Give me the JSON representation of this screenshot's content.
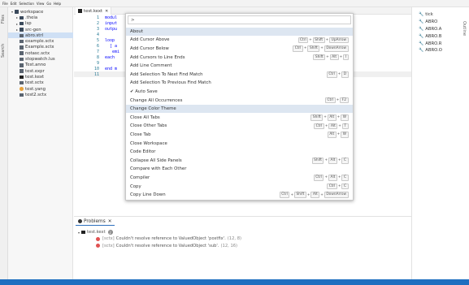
{
  "menubar": [
    "File",
    "Edit",
    "Selection",
    "View",
    "Go",
    "Help"
  ],
  "activity": {
    "files": "Files",
    "search": "Search"
  },
  "explorer": {
    "items": [
      {
        "label": "workspace",
        "type": "folder",
        "twisty": "▾",
        "depth": 0
      },
      {
        "label": ".theia",
        "type": "folder",
        "twisty": "▸",
        "depth": 1
      },
      {
        "label": "lsp",
        "type": "folder",
        "twisty": "▸",
        "depth": 1
      },
      {
        "label": "src-gen",
        "type": "folder",
        "twisty": "▸",
        "depth": 1
      },
      {
        "label": "abro.strl",
        "type": "file",
        "depth": 1,
        "selected": true
      },
      {
        "label": "example.sctx",
        "type": "file",
        "depth": 1
      },
      {
        "label": "Example.sctx",
        "type": "file",
        "depth": 1
      },
      {
        "label": "notasc.sctx",
        "type": "file",
        "depth": 1
      },
      {
        "label": "stopwatch.lus",
        "type": "file",
        "depth": 1
      },
      {
        "label": "Test.anno",
        "type": "file",
        "depth": 1
      },
      {
        "label": "test.expr",
        "type": "file",
        "depth": 1
      },
      {
        "label": "test.kext",
        "type": "kext",
        "depth": 1
      },
      {
        "label": "test.sctx",
        "type": "file",
        "depth": 1
      },
      {
        "label": "test.yang",
        "type": "yang",
        "depth": 1
      },
      {
        "label": "test2.sctx",
        "type": "file",
        "depth": 1
      }
    ]
  },
  "editor": {
    "tab_label": "test.kext",
    "tab_close": "✕",
    "line_numbers": [
      "1",
      "2",
      "3",
      "4",
      "5",
      "6",
      "7",
      "8",
      "9",
      "10",
      "11"
    ],
    "lines": [
      "modul",
      "input",
      "outpu",
      "",
      "loop",
      "  [ a",
      "   emi",
      "each",
      "",
      "end m",
      ""
    ]
  },
  "quickpick": {
    "input_value": ">",
    "items": [
      {
        "label": "About",
        "keys": [],
        "highlight": true
      },
      {
        "label": "Add Cursor Above",
        "keys": [
          "Ctrl",
          "Shift",
          "UpArrow"
        ]
      },
      {
        "label": "Add Cursor Below",
        "keys": [
          "Ctrl",
          "Shift",
          "DownArrow"
        ]
      },
      {
        "label": "Add Cursors to Line Ends",
        "keys": [
          "Shift",
          "Alt",
          "I"
        ]
      },
      {
        "label": "Add Line Comment",
        "keys": []
      },
      {
        "label": "Add Selection To Next Find Match",
        "keys": [
          "Ctrl",
          "D"
        ]
      },
      {
        "label": "Add Selection To Previous Find Match",
        "keys": []
      },
      {
        "label": "Auto Save",
        "keys": [],
        "checked": true
      },
      {
        "label": "Change All Occurrences",
        "keys": [
          "Ctrl",
          "F2"
        ]
      },
      {
        "label": "Change Color Theme",
        "keys": [],
        "highlight": true
      },
      {
        "label": "Close All Tabs",
        "keys": [
          "Shift",
          "Alt",
          "W"
        ]
      },
      {
        "label": "Close Other Tabs",
        "keys": [
          "Ctrl",
          "Alt",
          "T"
        ]
      },
      {
        "label": "Close Tab",
        "keys": [
          "Alt",
          "W"
        ]
      },
      {
        "label": "Close Workspace",
        "keys": []
      },
      {
        "label": "Code Editor",
        "keys": []
      },
      {
        "label": "Collapse All Side Panels",
        "keys": [
          "Shift",
          "Alt",
          "C"
        ]
      },
      {
        "label": "Compare with Each Other",
        "keys": []
      },
      {
        "label": "Compiler",
        "keys": [
          "Ctrl",
          "Alt",
          "C"
        ]
      },
      {
        "label": "Copy",
        "keys": [
          "Ctrl",
          "C"
        ]
      },
      {
        "label": "Copy Line Down",
        "keys": [
          "Ctrl",
          "Shift",
          "Alt",
          "DownArrow"
        ]
      }
    ]
  },
  "outline": {
    "items": [
      "tick",
      "ABRO",
      "ABRO.A",
      "ABRO.B",
      "ABRO.R",
      "ABRO.O"
    ],
    "side_label": "Outline"
  },
  "problems": {
    "tab_label": "Problems",
    "tab_close": "✕",
    "file": "test.kext",
    "count": "2",
    "errors": [
      {
        "source": "[sctx]",
        "message": "Couldn't resolve reference to ValuedObject 'postfix'.",
        "location": "(12, 8)"
      },
      {
        "source": "[sctx]",
        "message": "Couldn't resolve reference to ValuedObject 'sub'.",
        "location": "(12, 16)"
      }
    ]
  },
  "colors": {
    "accent": "#1e6fc0",
    "error": "#e05252",
    "selection": "#cfe0f5"
  }
}
